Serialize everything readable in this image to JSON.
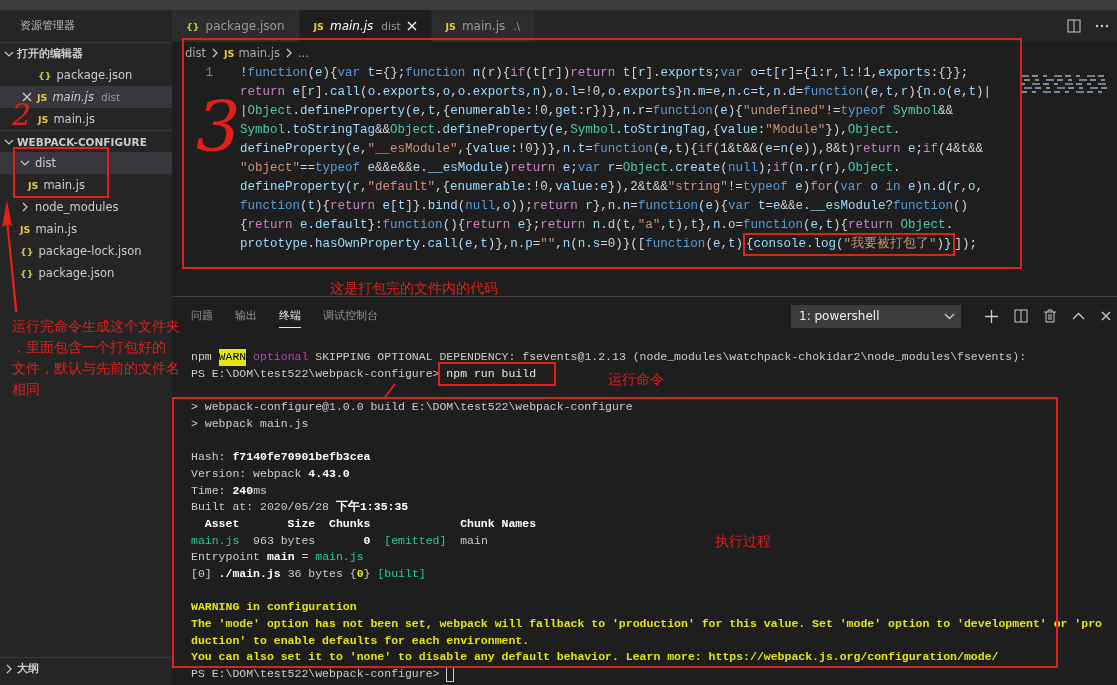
{
  "sidebar": {
    "title": "资源管理器",
    "open_editors": {
      "label": "打开的编辑器",
      "expanded": true,
      "items": [
        {
          "name": "package.json",
          "icon": "{}",
          "kind": "json",
          "selected": false,
          "preview": false
        },
        {
          "name": "main.js",
          "detail": "dist",
          "icon": "JS",
          "kind": "js",
          "selected": true,
          "preview": true
        },
        {
          "name": "main.js",
          "icon": "JS",
          "kind": "js",
          "selected": false,
          "preview": false
        }
      ]
    },
    "project": {
      "label": "WEBPACK-CONFIGURE",
      "expanded": true,
      "items": [
        {
          "name": "dist",
          "kind": "folder",
          "expanded": true,
          "selected": true,
          "children": [
            {
              "name": "main.js",
              "icon": "JS",
              "kind": "js",
              "selected": false
            }
          ]
        },
        {
          "name": "node_modules",
          "kind": "folder",
          "expanded": false,
          "selected": false
        },
        {
          "name": "main.js",
          "icon": "JS",
          "kind": "js",
          "selected": false
        },
        {
          "name": "package-lock.json",
          "icon": "{}",
          "kind": "json",
          "selected": false
        },
        {
          "name": "package.json",
          "icon": "{}",
          "kind": "json",
          "selected": false
        }
      ]
    },
    "outline": {
      "label": "大纲",
      "expanded": false
    }
  },
  "editor": {
    "tabs": [
      {
        "name": "package.json",
        "icon": "{}",
        "kind": "json",
        "selected": false,
        "preview": false
      },
      {
        "name": "main.js",
        "detail": "dist",
        "icon": "JS",
        "kind": "js",
        "selected": true,
        "preview": true
      },
      {
        "name": "main.js",
        "detail": ".\\",
        "icon": "JS",
        "kind": "js",
        "selected": false,
        "preview": false
      }
    ],
    "breadcrumb": [
      {
        "text": "dist"
      },
      {
        "text": "main.js",
        "icon": "JS"
      },
      {
        "text": "..."
      }
    ],
    "line_number": "1",
    "lines": [
      {
        "text": "!function(e){var t={};function n(r){if(t[r])return t[r].exports;var o=t[r]={i:r,l:!1,exports:{}};"
      },
      {
        "text": "return e[r].call(o.exports,o,o.exports,n),o.l=!0,o.exports}n.m=e,n.c=t,n.d=function(e,t,r){n.o(e,t)|"
      },
      {
        "text": "|Object.defineProperty(e,t,{enumerable:!0,get:r})},n.r=function(e){\"undefined\"!=typeof Symbol&&"
      },
      {
        "text": "Symbol.toStringTag&&Object.defineProperty(e,Symbol.toStringTag,{value:\"Module\"}),Object."
      },
      {
        "text": "defineProperty(e,\"__esModule\",{value:!0})},n.t=function(e,t){if(1&t&&(e=n(e)),8&t)return e;if(4&t&&"
      },
      {
        "text": "\"object\"==typeof e&&e&&e.__esModule)return e;var r=Object.create(null);if(n.r(r),Object."
      },
      {
        "text": "defineProperty(r,\"default\",{enumerable:!0,value:e}),2&t&&\"string\"!=typeof e)for(var o in e)n.d(r,o,"
      },
      {
        "text": "function(t){return e[t]}.bind(null,o));return r},n.n=function(e){var t=e&&e.__esModule?function()"
      },
      {
        "text": "{return e.default}:function(){return e};return n.d(t,\"a\",t),t},n.o=function(e,t){return Object."
      },
      {
        "text": "prototype.hasOwnProperty.call(e,t)},n.p=\"\",n(n.s=0)}([function(e,t)",
        "boxed": "{console.log(\"我要被打包了\")}",
        "after": "]);"
      }
    ]
  },
  "panel": {
    "tabs": [
      {
        "label": "问题",
        "selected": false
      },
      {
        "label": "输出",
        "selected": false
      },
      {
        "label": "终端",
        "selected": true
      },
      {
        "label": "调试控制台",
        "selected": false
      }
    ],
    "terminal_select": "1: powershell",
    "terminal": [
      {
        "kind": "text",
        "segments": [
          {
            "t": "npm ",
            "kind": "plain"
          },
          {
            "t": "WARN",
            "kind": "badge"
          },
          {
            "t": " optional",
            "kind": "magenta"
          },
          {
            "t": " SKIPPING OPTIONAL DEPENDENCY: fsevents@1.2.13 (node_modules\\watchpack-chokidar2\\node_modules\\fsevents):",
            "kind": "plain"
          }
        ]
      },
      {
        "kind": "text",
        "segments": [
          {
            "t": "PS E:\\DOM\\test522\\webpack-configure> ",
            "kind": "plain"
          },
          {
            "t": "npm run build",
            "kind": "boxed"
          }
        ]
      },
      {
        "kind": "blank"
      },
      {
        "kind": "text",
        "segments": [
          {
            "t": "> webpack-configure@1.0.0 build E:\\DOM\\test522\\webpack-configure",
            "kind": "plain"
          }
        ]
      },
      {
        "kind": "text",
        "segments": [
          {
            "t": "> webpack main.js",
            "kind": "plain"
          }
        ]
      },
      {
        "kind": "blank"
      },
      {
        "kind": "text",
        "segments": [
          {
            "t": "Hash: ",
            "kind": "plain"
          },
          {
            "t": "f7140fe70901befb3cea",
            "kind": "bold"
          }
        ]
      },
      {
        "kind": "text",
        "segments": [
          {
            "t": "Version: webpack ",
            "kind": "plain"
          },
          {
            "t": "4.43.0",
            "kind": "bold"
          }
        ]
      },
      {
        "kind": "text",
        "segments": [
          {
            "t": "Time: ",
            "kind": "plain"
          },
          {
            "t": "240",
            "kind": "bold"
          },
          {
            "t": "ms",
            "kind": "plain"
          }
        ]
      },
      {
        "kind": "text",
        "segments": [
          {
            "t": "Built at: 2020/05/28 ",
            "kind": "plain"
          },
          {
            "t": "下午1:35:35",
            "kind": "bold"
          }
        ]
      },
      {
        "kind": "text",
        "segments": [
          {
            "t": "  Asset       Size  Chunks             Chunk Names",
            "kind": "bold"
          }
        ]
      },
      {
        "kind": "text",
        "segments": [
          {
            "t": "main.js",
            "kind": "green"
          },
          {
            "t": "  963 bytes       ",
            "kind": "plain"
          },
          {
            "t": "0",
            "kind": "bold"
          },
          {
            "t": "  [emitted]",
            "kind": "green"
          },
          {
            "t": "  main",
            "kind": "plain"
          }
        ]
      },
      {
        "kind": "text",
        "segments": [
          {
            "t": "Entrypoint ",
            "kind": "plain"
          },
          {
            "t": "main",
            "kind": "bold"
          },
          {
            "t": " = ",
            "kind": "plain"
          },
          {
            "t": "main.js",
            "kind": "green"
          }
        ]
      },
      {
        "kind": "text",
        "segments": [
          {
            "t": "[0] ",
            "kind": "plain"
          },
          {
            "t": "./main.js",
            "kind": "bold"
          },
          {
            "t": " 36 bytes {",
            "kind": "plain"
          },
          {
            "t": "0",
            "kind": "yellow"
          },
          {
            "t": "} ",
            "kind": "plain"
          },
          {
            "t": "[built]",
            "kind": "green"
          }
        ]
      },
      {
        "kind": "blank"
      },
      {
        "kind": "text",
        "segments": [
          {
            "t": "WARNING in configuration",
            "kind": "yellow"
          }
        ]
      },
      {
        "kind": "text",
        "segments": [
          {
            "t": "The 'mode' option has not been set, webpack will fallback to 'production' for this value. Set 'mode' option to 'development' or 'pro",
            "kind": "yellow"
          }
        ]
      },
      {
        "kind": "text",
        "segments": [
          {
            "t": "duction' to enable defaults for each environment.",
            "kind": "yellow"
          }
        ]
      },
      {
        "kind": "text",
        "segments": [
          {
            "t": "You can also set it to 'none' to disable any default behavior. Learn more: https://webpack.js.org/configuration/mode/",
            "kind": "yellow"
          }
        ]
      },
      {
        "kind": "text",
        "cursor": true,
        "segments": [
          {
            "t": "PS E:\\DOM\\test522\\webpack-configure> ",
            "kind": "plain"
          }
        ]
      }
    ]
  },
  "annotations": {
    "code_label": "这是打包完的文件内的代码",
    "command_label": "运行命令",
    "process_label": "执行过程",
    "folder_note_lines": [
      "运行完命令生成这个文件夹",
      "，里面包含一个打包好的",
      "文件，默认与先前的文件名",
      "相同"
    ],
    "marks": [
      "2",
      "3"
    ]
  }
}
